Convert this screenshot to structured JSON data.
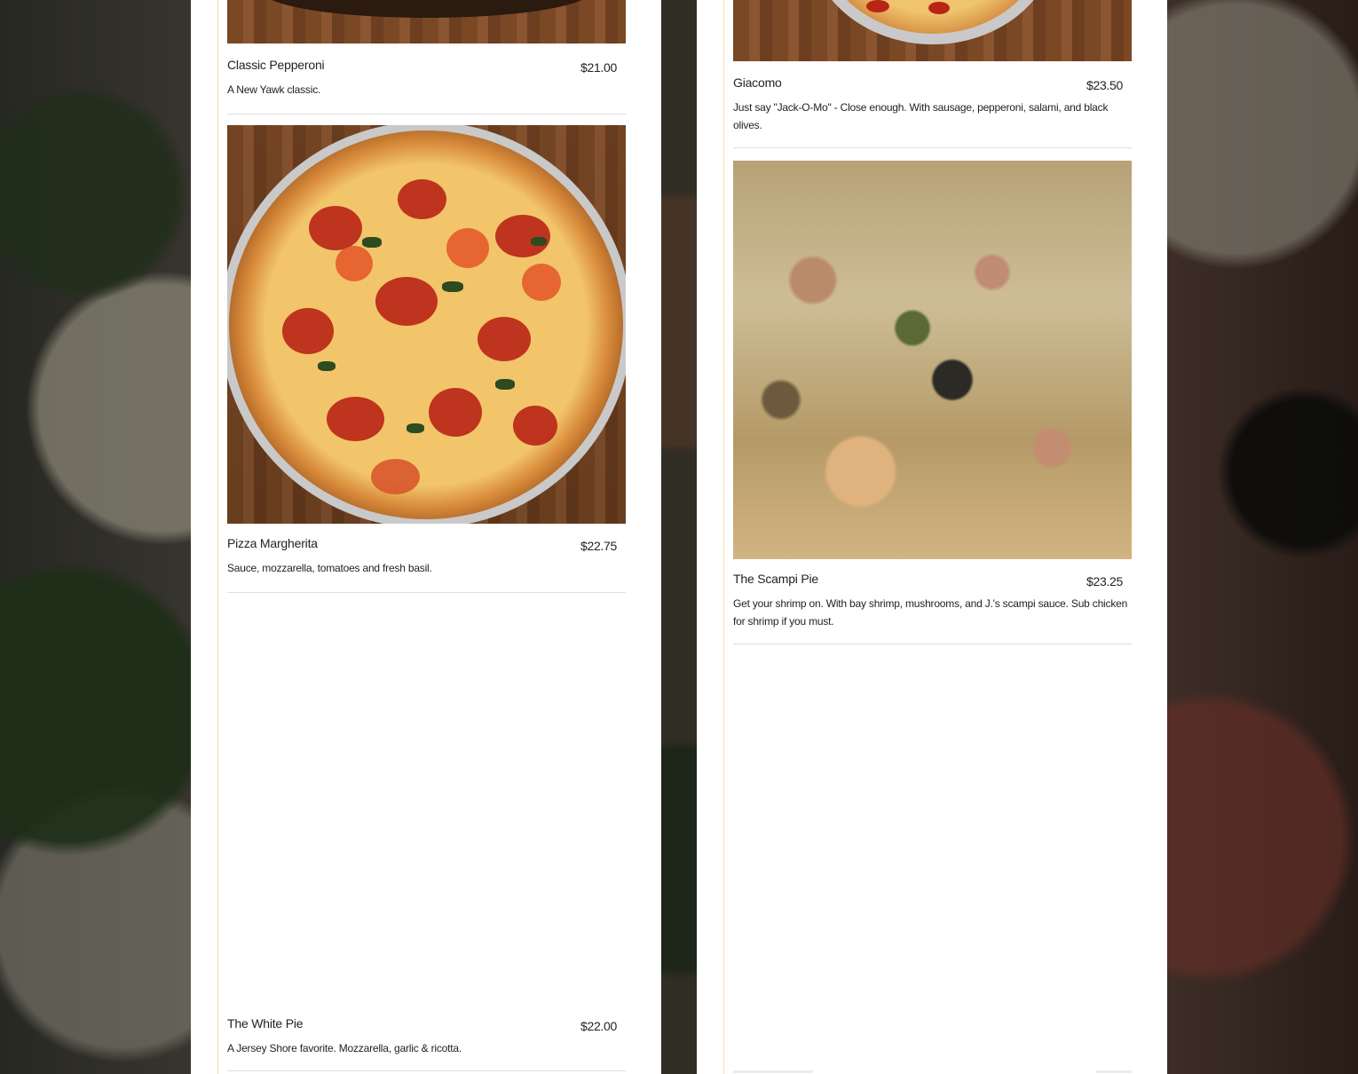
{
  "menu": {
    "left_column": [
      {
        "name": "Classic Pepperoni",
        "price": "$21.00",
        "description": "A New Yawk classic.",
        "photo": "pepperoni-pizza-photo"
      },
      {
        "name": "Pizza Margherita",
        "price": "$22.75",
        "description": "Sauce, mozzarella, tomatoes and fresh basil.",
        "photo": "margherita-pizza-photo"
      },
      {
        "name": "The White Pie",
        "price": "$22.00",
        "description": "A Jersey Shore favorite. Mozzarella, garlic & ricotta.",
        "photo": ""
      }
    ],
    "right_column": [
      {
        "name": "Giacomo",
        "price": "$23.50",
        "description": "Just say \"Jack-O-Mo\" - Close enough. With sausage, pepperoni, salami, and black olives.",
        "photo": "giacomo-pizza-photo"
      },
      {
        "name": "The Scampi Pie",
        "price": "$23.25",
        "description": "Get your shrimp on. With bay shrimp, mushrooms, and J.'s scampi sauce. Sub chicken for shrimp if you must.",
        "photo": "scampi-pizza-photo"
      }
    ]
  },
  "colors": {
    "column_bg": "#ffffff",
    "accent_rule": "#f4e3a2",
    "divider": "#dedede",
    "text": "#222222"
  }
}
